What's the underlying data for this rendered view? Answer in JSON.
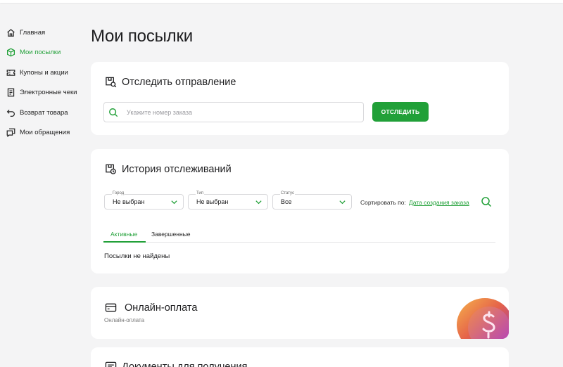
{
  "sidebar": {
    "items": [
      {
        "label": "Главная",
        "icon": "home-icon",
        "active": false
      },
      {
        "label": "Мои посылки",
        "icon": "box-icon",
        "active": true
      },
      {
        "label": "Купоны и акции",
        "icon": "coupon-icon",
        "active": false
      },
      {
        "label": "Электронные чеки",
        "icon": "receipt-icon",
        "active": false
      },
      {
        "label": "Возврат товара",
        "icon": "return-icon",
        "active": false
      },
      {
        "label": "Мои обращения",
        "icon": "chat-icon",
        "active": false
      }
    ]
  },
  "page": {
    "title": "Мои посылки"
  },
  "track": {
    "title": "Отследить отправление",
    "search_placeholder": "Укажите номер заказа",
    "search_value": "",
    "button_label": "ОТСЛЕДИТЬ"
  },
  "history": {
    "title": "История отслеживаний",
    "filters": [
      {
        "label": "Город",
        "value": "Не выбран"
      },
      {
        "label": "Тип",
        "value": "Не выбран"
      },
      {
        "label": "Статус",
        "value": "Все"
      }
    ],
    "sort_label": "Сортировать по:",
    "sort_value": "Дата создания заказа",
    "tabs": [
      {
        "label": "Активные",
        "active": true
      },
      {
        "label": "Завершенные",
        "active": false
      }
    ],
    "empty_message": "Посылки не найдены"
  },
  "payment": {
    "title": "Онлайн-оплата",
    "subtitle": "Онлайн-оплата"
  },
  "documents": {
    "title": "Документы для получения"
  },
  "colors": {
    "accent": "#21a038",
    "background": "#f4f4f5",
    "card": "#ffffff"
  }
}
